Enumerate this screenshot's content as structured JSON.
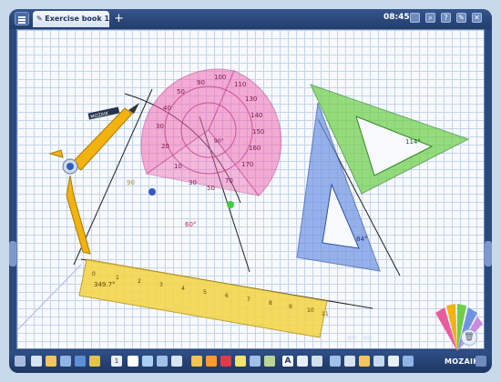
{
  "app": {
    "tab_title": "Exercise book 1",
    "clock": "08:45",
    "brand": "MOZAIK"
  },
  "top_icons": [
    "?",
    "?",
    "?",
    "?",
    "?"
  ],
  "canvas": {
    "compass_label": "MOZAIK",
    "protractor_labels": [
      "0",
      "10",
      "20",
      "30",
      "40",
      "50",
      "60",
      "70",
      "80",
      "90",
      "100",
      "110",
      "120",
      "130",
      "140",
      "150",
      "160",
      "170"
    ],
    "protractor_angle": "90°",
    "angle_90": "90",
    "angle_60": "60°",
    "ruler_ticks": [
      "0",
      "1",
      "2",
      "3",
      "4",
      "5",
      "6",
      "7",
      "8",
      "9",
      "10",
      "11"
    ],
    "ruler_angle": "349.7°",
    "green_square_angle": "114°",
    "blue_square_angle": "84°"
  },
  "bottom_toolbar": {
    "page_number": "1"
  }
}
